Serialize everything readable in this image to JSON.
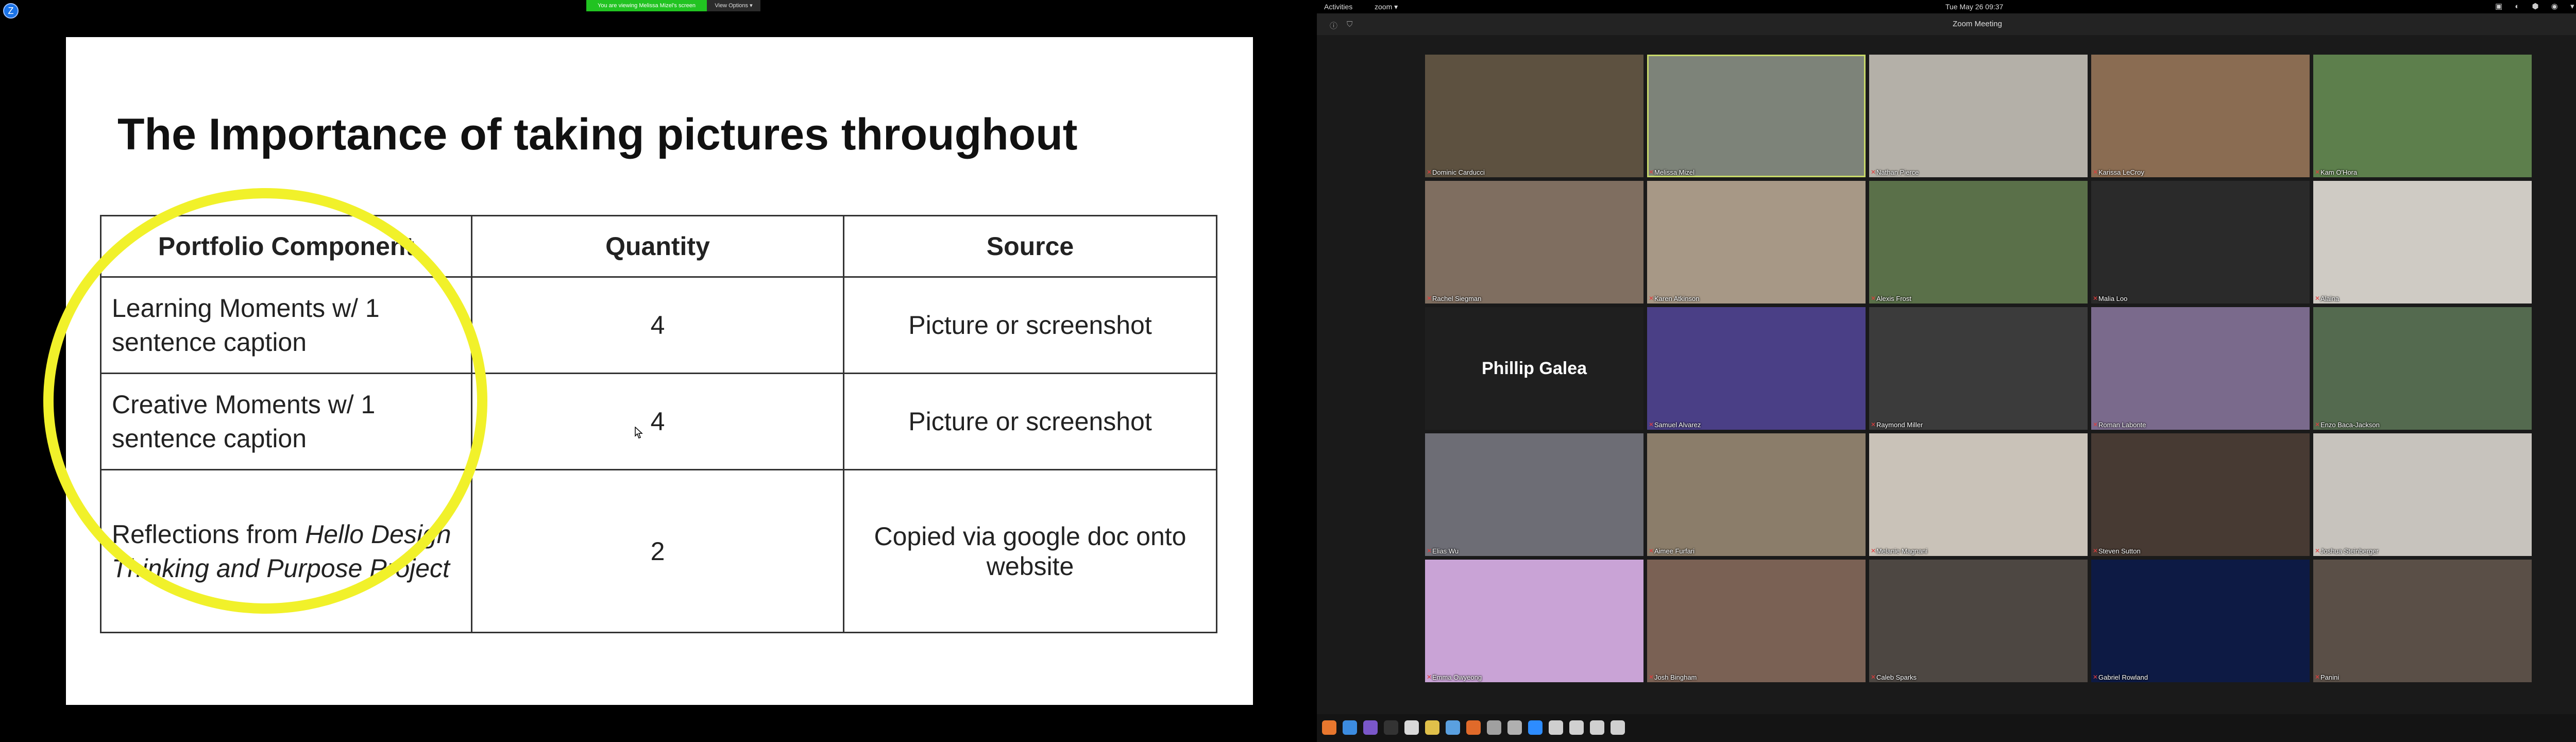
{
  "share": {
    "banner": "You are viewing Melissa Mizel's screen",
    "view_options": "View Options ▾",
    "corner_icon": "Z"
  },
  "slide": {
    "title": "The Importance of taking pictures throughout",
    "headers": [
      "Portfolio Component",
      "Quantity",
      "Source"
    ],
    "rows": [
      {
        "component": "Learning Moments w/ 1 sentence caption",
        "quantity": "4",
        "source": "Picture or screenshot"
      },
      {
        "component": "Creative Moments w/ 1 sentence caption",
        "quantity": "4",
        "source": "Picture or screenshot"
      },
      {
        "component_prefix": "Reflections from ",
        "component_italic": "Hello Design Thinking and Purpose Project",
        "quantity": "2",
        "source": "Copied via google doc onto website"
      }
    ],
    "highlight_color": "#f1f12a"
  },
  "desktop": {
    "activities": "Activities",
    "app_menu": "zoom ▾",
    "clock": "Tue May 26  09:37",
    "tray": "▣ ◐ ⬢ ◉ ▾ ▾ ◀ ⏻"
  },
  "zoom": {
    "title": "Zoom Meeting",
    "speaker_color": "#c8d96a",
    "participants": [
      {
        "name": "Dominic Carducci",
        "bg": "#5d5140"
      },
      {
        "name": "Melissa Mizel",
        "bg": "#7d8379",
        "speaker": true
      },
      {
        "name": "Nathan Pierce",
        "bg": "#b4b0a8"
      },
      {
        "name": "Karissa LeCroy",
        "bg": "#8a6c52"
      },
      {
        "name": "Kam O'Hora",
        "bg": "#5d7f4c"
      },
      {
        "name": "Rachel Siegman",
        "bg": "#7f6e60"
      },
      {
        "name": "Karen Atkinson",
        "bg": "#a79886"
      },
      {
        "name": "Alexis Frost",
        "bg": "#5a7049"
      },
      {
        "name": "Malia Loo",
        "bg": "#2a2a2a"
      },
      {
        "name": "Alaina",
        "bg": "#cfcbc4"
      },
      {
        "name": "Phillip Galea",
        "bg": "#1f1f1f",
        "name_only": true
      },
      {
        "name": "Samuel Alvarez",
        "bg": "#4a3f86"
      },
      {
        "name": "Raymond Miller",
        "bg": "#3b3b3b"
      },
      {
        "name": "Roman Labonte",
        "bg": "#7a6a8c"
      },
      {
        "name": "Enzo Baca-Jackson",
        "bg": "#546a4f"
      },
      {
        "name": "Elias Wu",
        "bg": "#6d6d75"
      },
      {
        "name": "Aimee Furfari",
        "bg": "#8b7d6a"
      },
      {
        "name": "Melanie Magnani",
        "bg": "#c9c2b8"
      },
      {
        "name": "Steven Sutton",
        "bg": "#473a33"
      },
      {
        "name": "Joshua Steinberger",
        "bg": "#c7c3bd"
      },
      {
        "name": "Emma Owyeong",
        "bg": "#c9a3d6"
      },
      {
        "name": "Josh Bingham",
        "bg": "#7a6154"
      },
      {
        "name": "Caleb Sparks",
        "bg": "#4d4742"
      },
      {
        "name": "Gabriel Rowland",
        "bg": "#0d1a44"
      },
      {
        "name": "Panini",
        "bg": "#5a4f47"
      }
    ]
  },
  "taskbar": {
    "icons": [
      "firefox-icon",
      "chromium-icon",
      "browser-icon",
      "terminal-icon",
      "files-icon",
      "disc-icon",
      "docs-icon",
      "home-folder-icon",
      "books-icon",
      "folder-icon",
      "zoom-icon",
      "calendar-icon",
      "document-icon",
      "document-icon",
      "document-icon"
    ],
    "colors": [
      "#e8772e",
      "#3c8ce0",
      "#7a57c9",
      "#333333",
      "#d9d9d9",
      "#e0c04a",
      "#5aa0e0",
      "#e06a2a",
      "#a0a0a0",
      "#b0b0b0",
      "#2d8cff",
      "#cfcfcf",
      "#d0d0d0",
      "#d0d0d0",
      "#d0d0d0"
    ]
  }
}
